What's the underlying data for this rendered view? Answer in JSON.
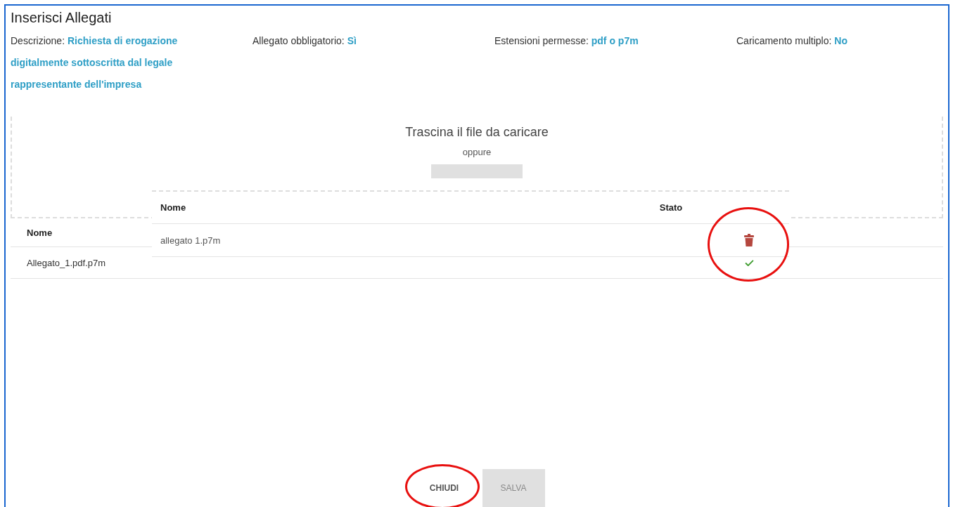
{
  "dialog": {
    "title": "Inserisci Allegati",
    "meta": [
      {
        "label": "Descrizione:",
        "value": "Richiesta di erogazione digitalmente sottoscritta dal legale rappresentante dell'impresa"
      },
      {
        "label": "Allegato obbligatorio:",
        "value": "Sì"
      },
      {
        "label": "Estensioni permesse:",
        "value": "pdf o p7m"
      },
      {
        "label": "Caricamento multiplo:",
        "value": "No"
      }
    ],
    "dropzone": {
      "prompt": "Trascina il file da caricare",
      "separator": "oppure"
    },
    "upload_panel": {
      "columns": [
        "Nome",
        "Stato"
      ],
      "rows": [
        {
          "name": "allegato 1.p7m",
          "kind": "removable",
          "highlighted": true
        }
      ]
    },
    "attachments_table": {
      "columns": [
        "Nome"
      ],
      "rows": [
        {
          "name": "Allegato_1.pdf.p7m",
          "kind": "verified"
        }
      ]
    },
    "buttons": [
      {
        "label": "CHIUDI",
        "disabled": false,
        "highlighted": true
      },
      {
        "label": "SALVA",
        "disabled": true,
        "highlighted": false
      }
    ]
  }
}
